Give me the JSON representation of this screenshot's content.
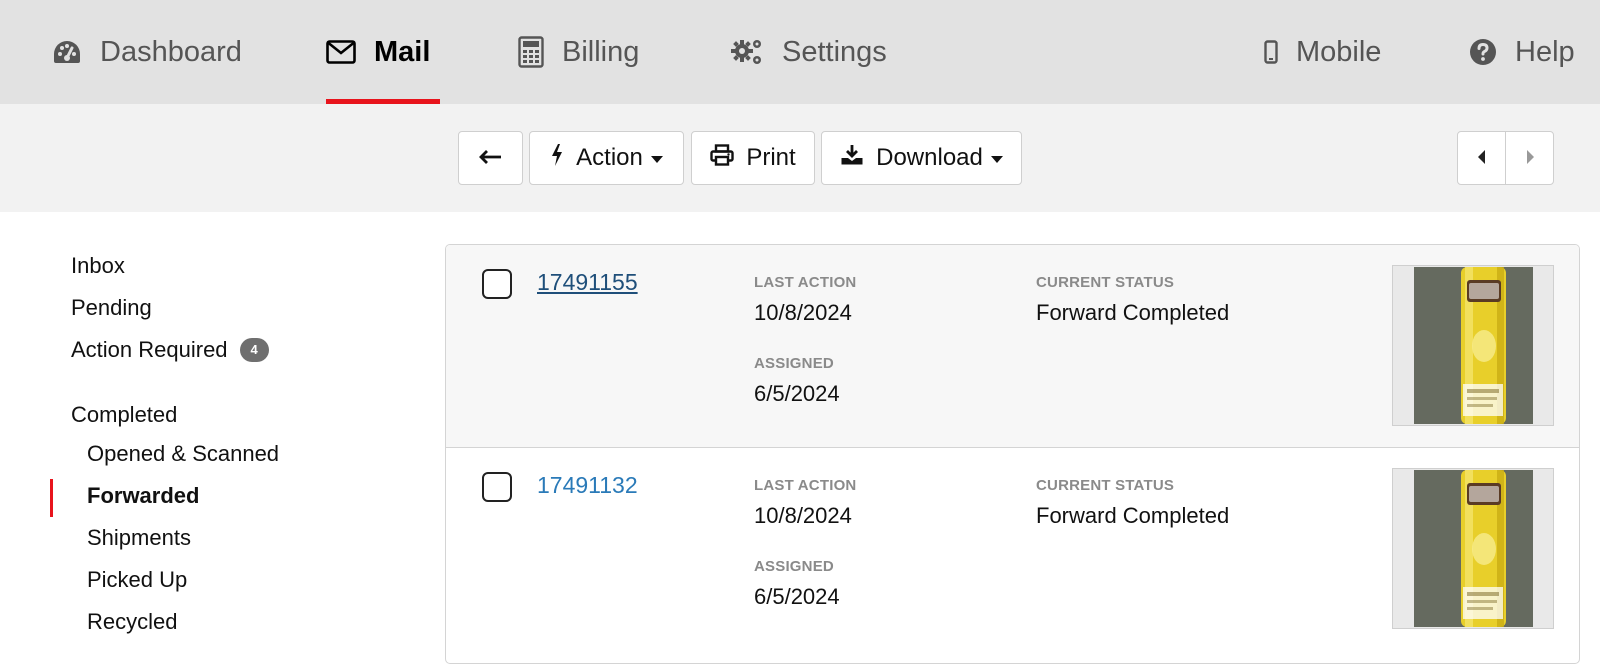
{
  "nav": {
    "dashboard": "Dashboard",
    "mail": "Mail",
    "billing": "Billing",
    "settings": "Settings",
    "mobile": "Mobile",
    "help": "Help"
  },
  "toolbar": {
    "action": "Action",
    "print": "Print",
    "download": "Download"
  },
  "sidebar": {
    "inbox": "Inbox",
    "pending": "Pending",
    "action_required": "Action Required",
    "action_required_count": "4",
    "completed": "Completed",
    "opened_scanned": "Opened & Scanned",
    "forwarded": "Forwarded",
    "shipments": "Shipments",
    "picked_up": "Picked Up",
    "recycled": "Recycled"
  },
  "mail_items": [
    {
      "id": "17491155",
      "last_action_label": "LAST ACTION",
      "last_action": "10/8/2024",
      "assigned_label": "ASSIGNED",
      "assigned": "6/5/2024",
      "status_label": "CURRENT STATUS",
      "status": "Forward Completed"
    },
    {
      "id": "17491132",
      "last_action_label": "LAST ACTION",
      "last_action": "10/8/2024",
      "assigned_label": "ASSIGNED",
      "assigned": "6/5/2024",
      "status_label": "CURRENT STATUS",
      "status": "Forward Completed"
    }
  ],
  "colors": {
    "accent": "#e8141c",
    "link": "#2a7ab8",
    "link_visited": "#1f4f7a"
  },
  "icons": [
    "dashboard-gauge-icon",
    "envelope-icon",
    "calculator-icon",
    "gears-icon",
    "mobile-phone-icon",
    "question-circle-icon",
    "arrow-left-icon",
    "bolt-icon",
    "printer-icon",
    "download-icon",
    "caret-left-icon",
    "caret-right-icon"
  ]
}
